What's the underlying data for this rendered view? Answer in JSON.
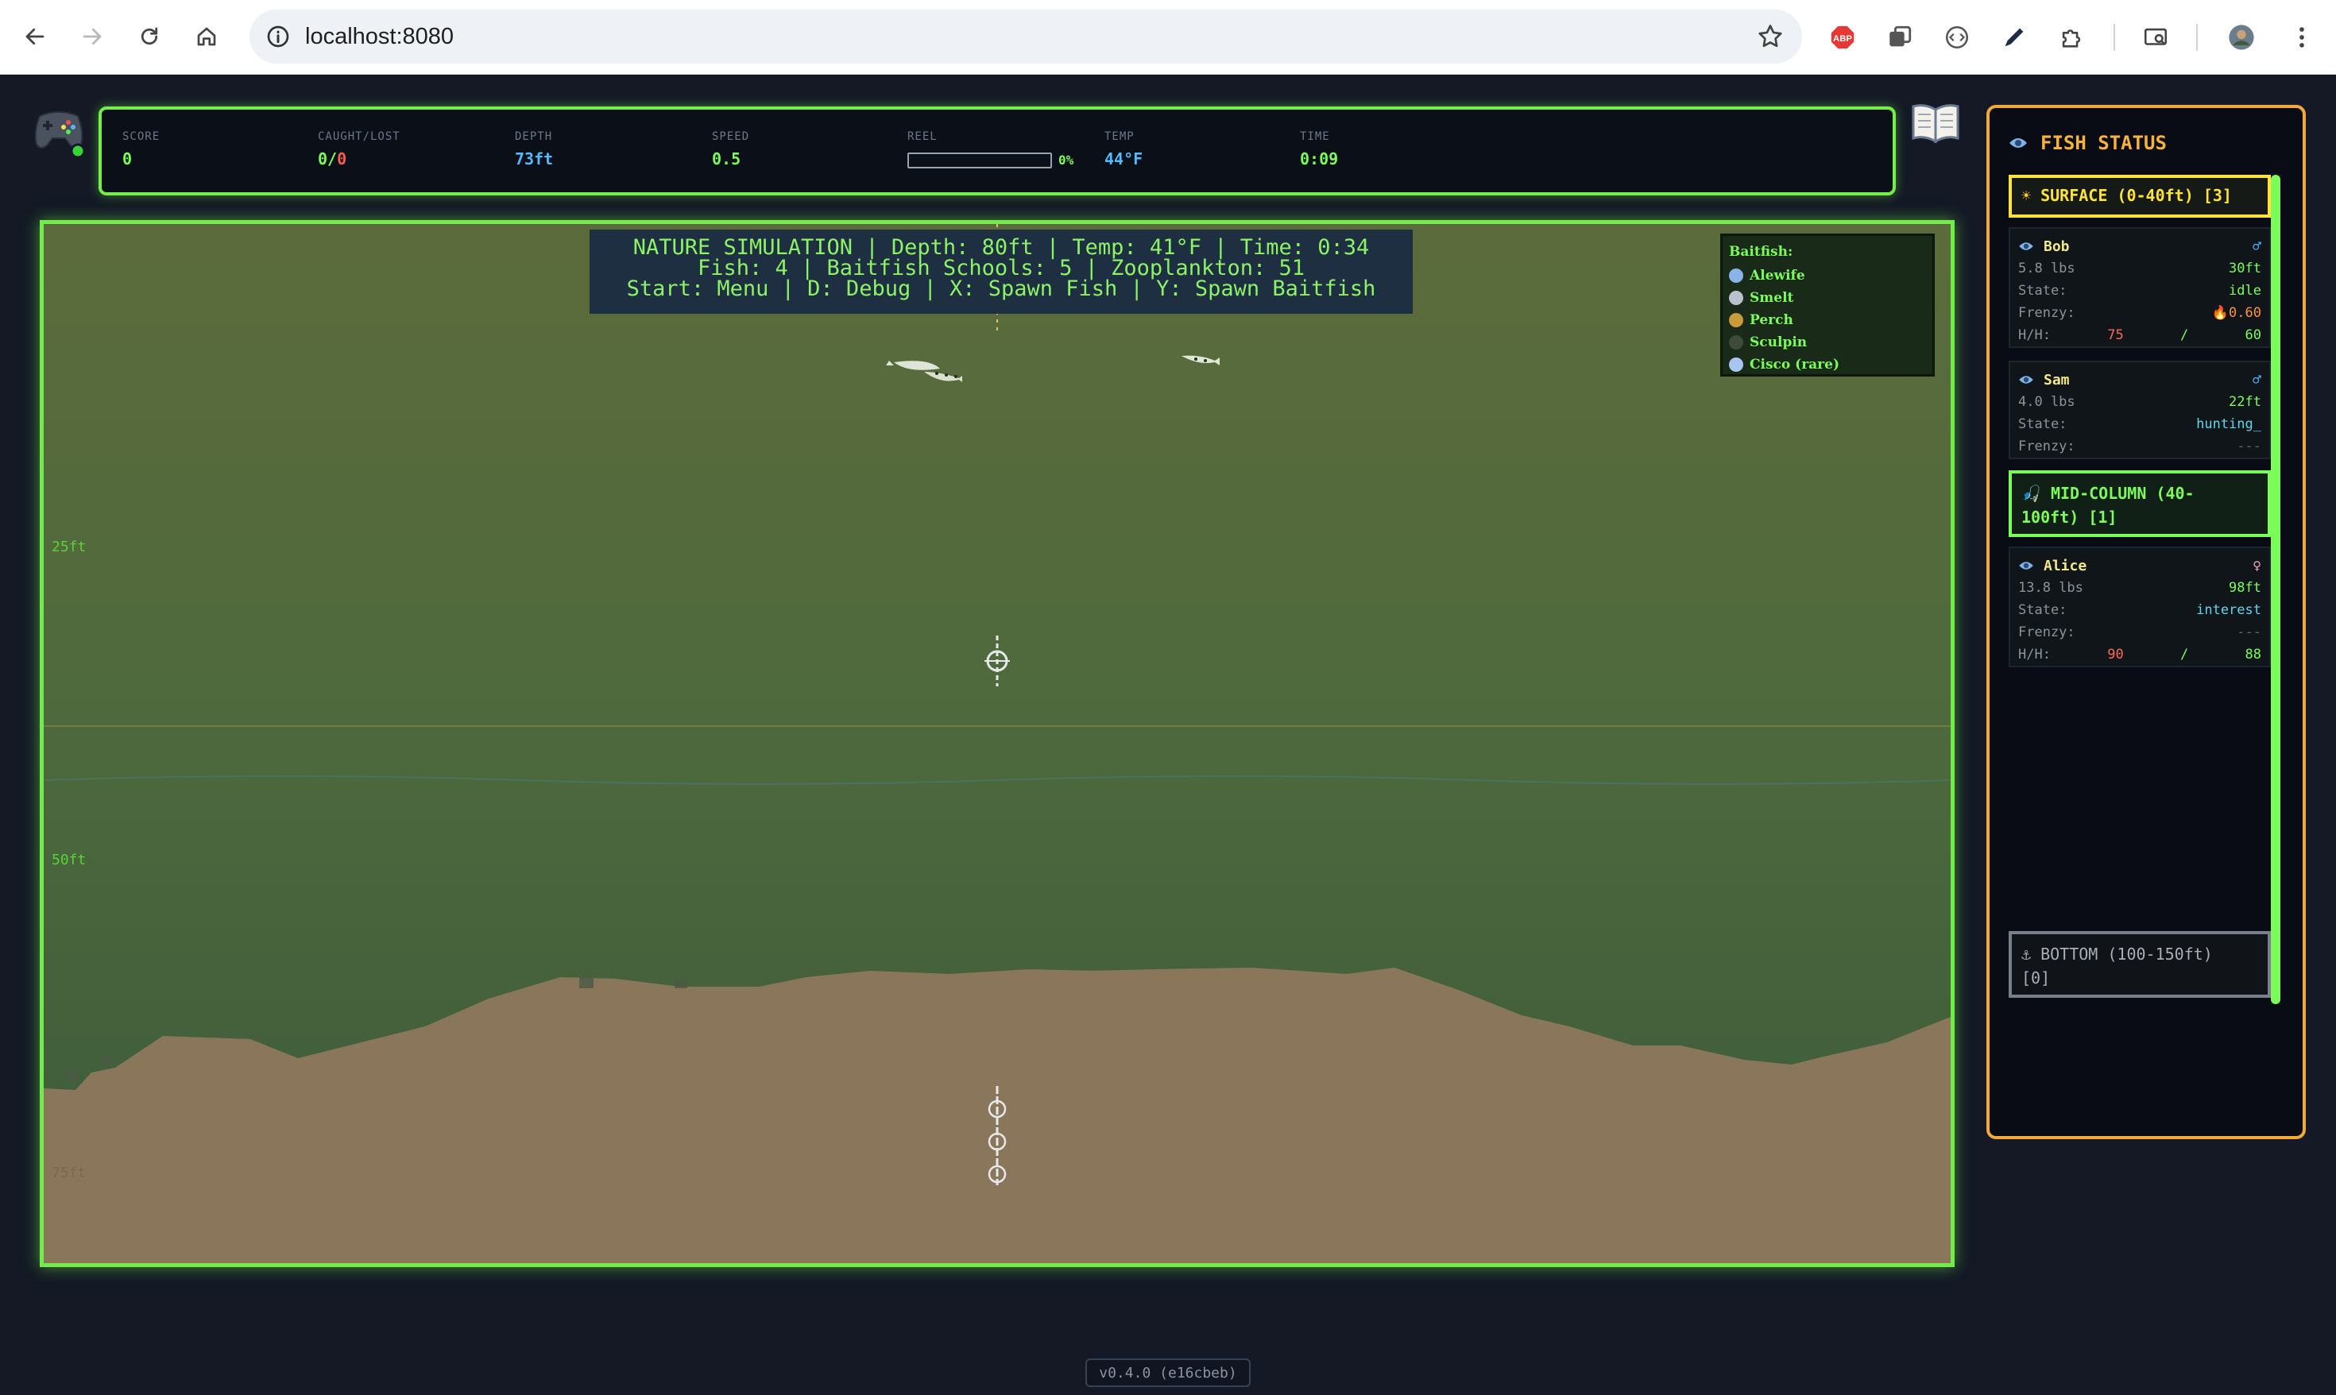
{
  "browser": {
    "url": "localhost:8080",
    "extensions": [
      "adblock-icon",
      "tab-search-icon",
      "code-icon",
      "eyedropper-icon",
      "puzzle-icon",
      "cast-icon",
      "profile-avatar"
    ]
  },
  "hud": {
    "score_label": "SCORE",
    "score_value": "0",
    "caught_label": "CAUGHT/LOST",
    "caught_value": "0/",
    "lost_value": "0",
    "depth_label": "DEPTH",
    "depth_value": "73ft",
    "speed_label": "SPEED",
    "speed_value": "0.5",
    "reel_label": "REEL",
    "reel_fraction": 0,
    "reel_pct": "0%",
    "temp_label": "TEMP",
    "temp_value": "44°F",
    "time_label": "TIME",
    "time_value": "0:09"
  },
  "simulation": {
    "line1": "NATURE SIMULATION | Depth: 80ft | Temp: 41°F | Time: 0:34",
    "line2": "Fish: 4 | Baitfish Schools: 5 | Zooplankton: 51",
    "line3": "Start: Menu | D: Debug | X: Spawn Fish | Y: Spawn Baitfish"
  },
  "depth_markers": [
    "25ft",
    "50ft",
    "75ft"
  ],
  "legend": {
    "title": "Baitfish:",
    "items": [
      {
        "label": "Alewife",
        "color": "#8ab4e8"
      },
      {
        "label": "Smelt",
        "color": "#b9c2cc"
      },
      {
        "label": "Perch",
        "color": "#c89a3a"
      },
      {
        "label": "Sculpin",
        "color": "#3f4a3a"
      },
      {
        "label": "Cisco (rare)",
        "color": "#a8c4f0"
      }
    ]
  },
  "fish_panel": {
    "title": "FISH STATUS",
    "surface_zone": "SURFACE (0-40ft) [3]",
    "mid_zone_line1": "MID-COLUMN (40-",
    "mid_zone_line2": "100ft) [1]",
    "bottom_zone_line1": "BOTTOM (100-150ft)",
    "bottom_zone_line2": "[0]",
    "fish": [
      {
        "name": "Bob",
        "gender": "♂",
        "weight": "5.8 lbs",
        "depth": "30ft",
        "state_label": "State:",
        "state": "idle",
        "frenzy_label": "Frenzy:",
        "frenzy": "0.60",
        "hh_label": "H/H:",
        "hunger": "75",
        "hh_sep": "/",
        "health": "60"
      },
      {
        "name": "Sam",
        "gender": "♂",
        "weight": "4.0 lbs",
        "depth": "22ft",
        "state_label": "State:",
        "state": "hunting_",
        "frenzy_label": "Frenzy:",
        "frenzy": "---"
      },
      {
        "name": "Alice",
        "gender": "♀",
        "weight": "13.8 lbs",
        "depth": "98ft",
        "state_label": "State:",
        "state": "interest",
        "frenzy_label": "Frenzy:",
        "frenzy": "---",
        "hh_label": "H/H:",
        "hunger": "90",
        "hh_sep": "/",
        "health": "88"
      }
    ]
  },
  "version": "v0.4.0 (e16cbeb)"
}
